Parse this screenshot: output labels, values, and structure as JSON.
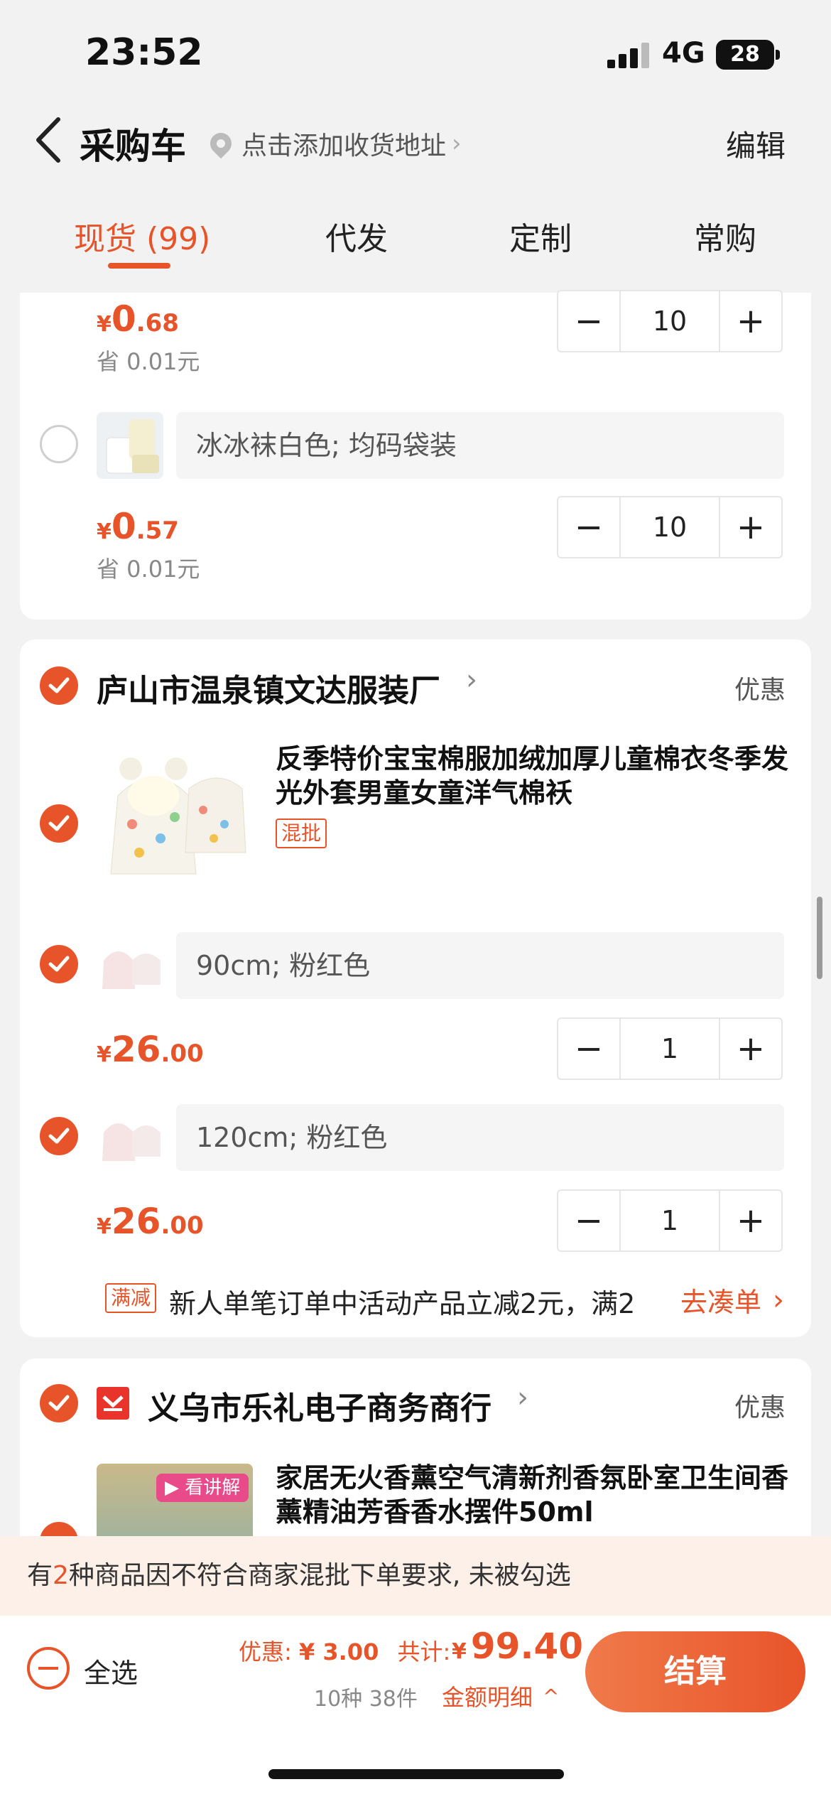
{
  "status_bar": {
    "time": "23:52",
    "network": "4G",
    "battery": "28"
  },
  "header": {
    "title": "采购车",
    "address_hint": "点击添加收货地址",
    "edit_label": "编辑"
  },
  "tabs": [
    {
      "label": "现货 (99)",
      "active": true
    },
    {
      "label": "代发"
    },
    {
      "label": "定制"
    },
    {
      "label": "常购"
    }
  ],
  "shop0": {
    "items": [
      {
        "price_yen": "¥",
        "price_int": "0",
        "price_dec": ".68",
        "save": "省 0.01元",
        "qty": "10"
      },
      {
        "sku": "冰冰袜白色; 均码袋装",
        "price_yen": "¥",
        "price_int": "0",
        "price_dec": ".57",
        "save": "省 0.01元",
        "qty": "10"
      }
    ]
  },
  "shop1": {
    "name": "庐山市温泉镇文达服装厂",
    "promo_label": "优惠",
    "product_title": "反季特价宝宝棉服加绒加厚儿童棉衣冬季发光外套男童女童洋气棉袄",
    "product_tag": "混批",
    "skus": [
      {
        "label": "90cm; 粉红色",
        "price_yen": "¥",
        "price_int": "26",
        "price_dec": ".00",
        "qty": "1"
      },
      {
        "label": "120cm; 粉红色",
        "price_yen": "¥",
        "price_int": "26",
        "price_dec": ".00",
        "qty": "1"
      }
    ],
    "discount_tag": "满减",
    "discount_text": "新人单笔订单中活动产品立减2元，满2",
    "discount_link": "去凑单"
  },
  "shop2": {
    "name": "义乌市乐礼电子商务商行",
    "promo_label": "优惠",
    "product_title": "家居无火香薰空气清新剂香氛卧室卫生间香薰精油芳香香水摆件50ml",
    "video_badge": "看讲解"
  },
  "notice": {
    "prefix": "有",
    "count": "2",
    "suffix": "种商品因不符合商家混批下单要求, 未被勾选"
  },
  "footer": {
    "select_all": "全选",
    "discount_label": "优惠:",
    "discount_value": "¥ 3.00",
    "total_label": "共计:",
    "total_yen": "¥",
    "total_value": "99.40",
    "summary": "10种 38件",
    "detail_link": "金额明细",
    "checkout_label": "结算"
  },
  "colors": {
    "accent": "#e8542a",
    "background": "#f2f2f2"
  }
}
